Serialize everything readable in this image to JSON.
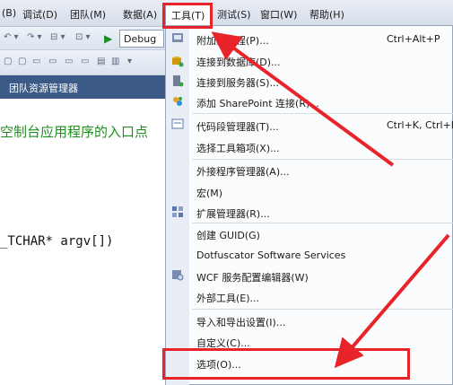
{
  "menubar": {
    "items": [
      "(B)",
      "调试(D)",
      "团队(M)",
      "数据(A)",
      "工具(T)",
      "测试(S)",
      "窗口(W)",
      "帮助(H)"
    ]
  },
  "toolbar": {
    "config": "Debug"
  },
  "team_tab": "团队资源管理器",
  "editor": {
    "comment": "空制台应用程序的入口点",
    "code": "_TCHAR* argv[])"
  },
  "tools_menu": {
    "items": [
      {
        "label": "附加到进程(P)...",
        "shortcut": "Ctrl+Alt+P"
      },
      {
        "label": "连接到数据库(D)..."
      },
      {
        "label": "连接到服务器(S)..."
      },
      {
        "label": "添加 SharePoint 连接(R)..."
      },
      {
        "label": "代码段管理器(T)...",
        "shortcut": "Ctrl+K, Ctrl+B"
      },
      {
        "label": "选择工具箱项(X)..."
      },
      {
        "label": "外接程序管理器(A)..."
      },
      {
        "label": "宏(M)"
      },
      {
        "label": "扩展管理器(R)..."
      },
      {
        "label": "创建 GUID(G)"
      },
      {
        "label": "Dotfuscator Software Services"
      },
      {
        "label": "WCF 服务配置编辑器(W)"
      },
      {
        "label": "外部工具(E)..."
      },
      {
        "label": "导入和导出设置(I)..."
      },
      {
        "label": "自定义(C)..."
      },
      {
        "label": "选项(O)..."
      }
    ]
  },
  "colors": {
    "highlight_red": "#e8232a",
    "comment_green": "#1e8f1e",
    "tab_blue": "#3c5a87"
  }
}
